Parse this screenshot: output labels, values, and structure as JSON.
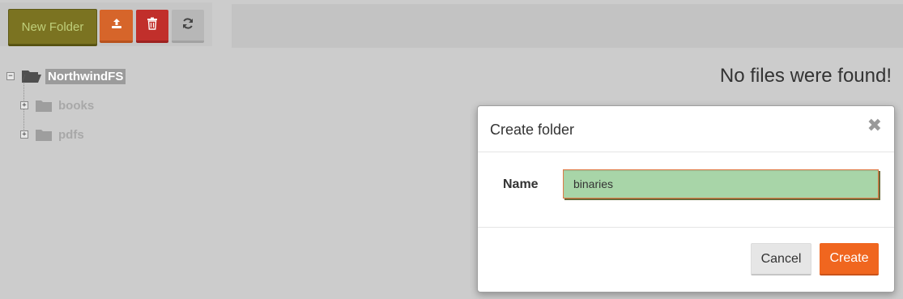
{
  "toolbar": {
    "new_folder_label": "New Folder",
    "upload_icon": "upload-icon",
    "delete_icon": "trash-icon",
    "refresh_icon": "refresh-icon"
  },
  "tree": {
    "root": {
      "label": "NorthwindFS",
      "expander": "−",
      "icon": "folder-open-icon"
    },
    "children": [
      {
        "label": "books",
        "expander": "+",
        "icon": "folder-icon"
      },
      {
        "label": "pdfs",
        "expander": "+",
        "icon": "folder-icon"
      }
    ]
  },
  "main": {
    "empty_message": "No files were found!"
  },
  "modal": {
    "title": "Create folder",
    "close_symbol": "✖",
    "name_label": "Name",
    "name_value": "binaries",
    "cancel_label": "Cancel",
    "create_label": "Create"
  },
  "colors": {
    "accent": "#f0661f",
    "danger": "#c12f2b",
    "new_folder_bg": "#7b7321",
    "input_bg": "#a8d5a8"
  }
}
